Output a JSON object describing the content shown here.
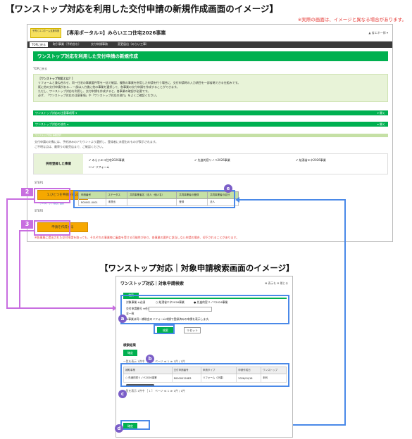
{
  "headline": "【ワンストップ対応を利用した交付申請の新規作成画面のイメージ】",
  "disclaimer": "※実際の画面は、イメージと異なる場合があります。",
  "screen1": {
    "logo_text": "子育てエコホーム支援事業",
    "portal_title": "【専用ポータル①】みらいエコ住宅2026事業",
    "user_menu": "▲ 省エネ一郎 ▾",
    "nav": [
      "TOPに戻る",
      "取引事業（予約含む）",
      "交付申請事務",
      "変更届出（みらい工事）"
    ],
    "page_title": "ワンストップ対応を利用した交付申請の新規作成",
    "back_link": "TOPに戻る",
    "info": {
      "heading": "［ワンストップ対応とは？］",
      "lines": [
        "リフォームと兼ね合わせ、同一住宅の事業要件等を一括で確認、複数の事業を併用した申請を行う場合に、交付申請時の入力項目を一部省略できる仕組みです。",
        "既に他の交付申請がある… 一部は入力後に他の事業を選択して、各事業の交付申請を作成することができます。",
        "ただし、ワンストップ対応を利用し、交付申請を作成すると、各事業の確認が必要です。",
        "必ず、「ワンストップ対応の注意事項」や「ワンストップ対応の流れ」をよくご確認ください。"
      ]
    },
    "bars": [
      "ワンストップ対応の注意事項等 ▾",
      "ワンストップ対応の流れ ▾"
    ],
    "bar_right": "▾ 開く",
    "section_small": "ワンストップ対応 事業選択",
    "select_note1": "交付申請の対象には、予約済みのアカウントより選択し、登録者に未提出のものが表示されます。",
    "select_note2": "ご不明な点は、最寄りの販売店まで、ご確認ください。",
    "subject_label": "併用登録した事業",
    "checkboxes": [
      "✔ みらいエコ住宅2026事業",
      "✔ 先進的窓リノベ2026事業",
      "✔ 給湯省エネ2026事業"
    ],
    "checkbox_sub": "☐ ✔ リフォーム",
    "step_label": "STEP1",
    "step_label2": "STEP2",
    "btn_select": "1.ひとつを申請を選ぶ",
    "btn_create": "申請を作成する",
    "small_link": "「ワンストップ対応」選択",
    "table_headers": [
      "申請番号",
      "ステータス",
      "共同事業者名（法人・個人名）",
      "共同事業者の登録",
      "共同事業者の区分"
    ],
    "table_row": [
      "R00001-0001",
      "未提出",
      "",
      "登録",
      "法人"
    ],
    "warn1": "※各事業に提出された交付申請を取っても、それぞれの事業毎に審査を受ける可能性があり、各事業の要件に該当しない申請の場合、却下されることがあります。",
    "warn2": "※詳しくはお問い合わせの上、確認願います。",
    "bottom_link": "TOPに戻る"
  },
  "badges": {
    "two": "2",
    "three": "3",
    "a": "a",
    "b": "b",
    "c": "c",
    "d": "d",
    "e": "e"
  },
  "headline2": "【ワンストップ対応｜対象申請検索画面のイメージ】",
  "screen2": {
    "title": "ワンストップ対応｜対象申請検索",
    "tools": "⊠ 表示を  ⊟ 閉じる",
    "tab": "検索",
    "row1_label": "対象事業 ※必須",
    "row1_options": [
      "○ 給湯省エネ2026事業",
      "● 先進的窓リノベ2026事業"
    ],
    "row2_label": "交付申請番号 ※任意",
    "row3_label": "全一致",
    "row4_note": "※事業は同一補助金のリフォーム申請で登録済みの申請を表示します。",
    "btn_search": "検索",
    "btn_reset": "リセット",
    "result_heading": "検索結果",
    "btn_confirm_top": "確定",
    "pager": "一覧を表示 1件中 ［ 1 ］ ページ  ≪  1  ≫  1件 / 1件",
    "result_headers": [
      "補助事業",
      "交付申請番号",
      "申請タイプ",
      "申請作成日",
      "ワンストップ"
    ],
    "result_row": [
      "○ 先進的窓リノベ2026事業",
      "R00000126B3",
      "リフォーム（戸建）",
      "2026/04/18",
      "未利"
    ],
    "btn_confirm_bottom": "確定"
  }
}
